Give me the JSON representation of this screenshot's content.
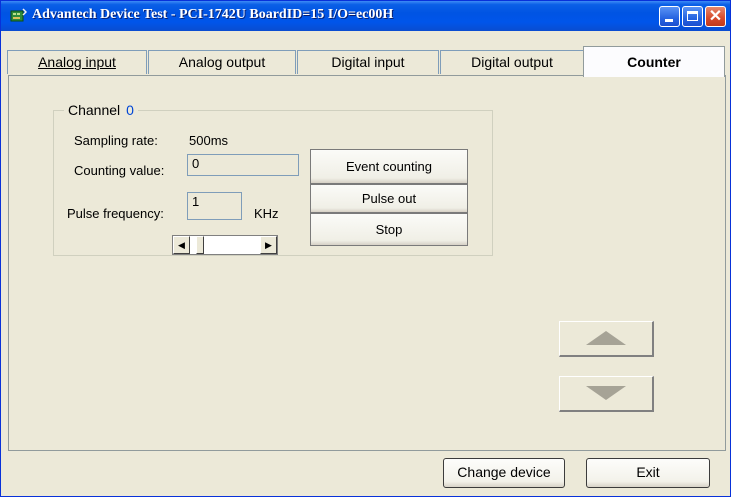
{
  "window": {
    "title": "Advantech Device Test - PCI-1742U BoardID=15 I/O=ec00H",
    "icons": {
      "app": "app-icon",
      "minimize": "minimize-icon",
      "maximize": "maximize-icon",
      "close": "close-icon"
    }
  },
  "tabs": [
    {
      "label": "Analog input",
      "selected": false
    },
    {
      "label": "Analog output",
      "selected": false
    },
    {
      "label": "Digital input",
      "selected": false
    },
    {
      "label": "Digital output",
      "selected": false
    },
    {
      "label": "Counter",
      "selected": true
    }
  ],
  "channel": {
    "title": "Channel",
    "number": "0",
    "sampling_label": "Sampling rate:",
    "sampling_value": "500ms",
    "counting_label": "Counting value:",
    "counting_value": "0",
    "pulse_label": "Pulse frequency:",
    "pulse_value": "1",
    "pulse_unit": "KHz",
    "buttons": {
      "event_counting": "Event counting",
      "pulse_out": "Pulse out",
      "stop": "Stop"
    },
    "scroll": {
      "left_icon": "arrow-left-icon",
      "right_icon": "arrow-right-icon"
    }
  },
  "nav": {
    "up_icon": "triangle-up-icon",
    "down_icon": "triangle-down-icon"
  },
  "footer": {
    "change_device": "Change device",
    "exit": "Exit"
  },
  "colors": {
    "titlebar": "#0054e3",
    "channel_number": "#0046d5",
    "face": "#ece9d8"
  }
}
